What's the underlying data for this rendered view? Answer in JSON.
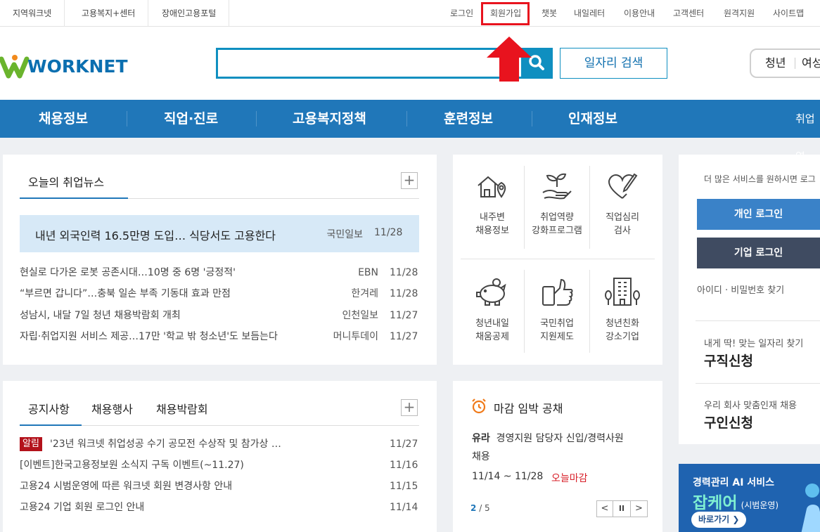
{
  "topbar": {
    "left_links": [
      "지역워크넷",
      "고용복지+센터",
      "장애인고용포털"
    ],
    "right_links": [
      "로그인",
      "회원가입",
      "챗봇",
      "내일레터",
      "이용안내",
      "고객센터",
      "원격지원",
      "사이트맵"
    ]
  },
  "header": {
    "logo": "WORKNET",
    "search_placeholder": "",
    "job_search_label": "일자리 검색",
    "toggle_a": "청년",
    "toggle_b": "여성"
  },
  "nav": {
    "items": [
      "채용정보",
      "직업·진로",
      "고용복지정책",
      "훈련정보",
      "인재정보",
      "취업역"
    ]
  },
  "news": {
    "title": "오늘의 취업뉴스",
    "plus": "+",
    "featured": {
      "headline": "내년 외국인력 16.5만명 도입… 식당서도 고용한다",
      "source": "국민일보",
      "date": "11/28"
    },
    "items": [
      {
        "headline": "현실로 다가온 로봇 공존시대…10명 중 6명 '긍정적'",
        "source": "EBN",
        "date": "11/28"
      },
      {
        "headline": "“부르면 갑니다”…충북 일손 부족 기동대 효과 만점",
        "source": "한겨레",
        "date": "11/28"
      },
      {
        "headline": "성남시, 내달 7일 청년 채용박람회 개최",
        "source": "인천일보",
        "date": "11/27"
      },
      {
        "headline": "자립·취업지원 서비스 제공…17만 '학교 밖 청소년'도 보듬는다",
        "source": "머니투데이",
        "date": "11/27"
      }
    ]
  },
  "services": [
    {
      "line1": "내주변",
      "line2": "채용정보",
      "icon": "house-location-icon"
    },
    {
      "line1": "취업역량",
      "line2": "강화프로그램",
      "icon": "sprout-hand-icon"
    },
    {
      "line1": "직업심리",
      "line2": "검사",
      "icon": "heart-pen-icon"
    },
    {
      "line1": "청년내일",
      "line2": "채움공제",
      "icon": "piggy-bank-icon"
    },
    {
      "line1": "국민취업",
      "line2": "지원제도",
      "icon": "thumbs-up-phone-icon"
    },
    {
      "line1": "청년친화",
      "line2": "강소기업",
      "icon": "building-icon"
    }
  ],
  "login": {
    "hint": "더 많은 서비스를 원하시면 로그",
    "personal_label": "개인 로그인",
    "company_label": "기업 로그인",
    "find_label": "아이디 · 비밀번호 찾기",
    "jobseek_sub": "내게 딱! 맞는 일자리 찾기",
    "jobseek_title": "구직신청",
    "hire_sub": "우리 회사 맞춤인재 채용",
    "hire_title": "구인신청"
  },
  "notice": {
    "tabs": [
      "공지사항",
      "채용행사",
      "채용박람회"
    ],
    "plus": "+",
    "badge": "알림",
    "items": [
      {
        "title": "'23년 워크넷 취업성공 수기 공모전 수상작 및 참가상 …",
        "date": "11/27"
      },
      {
        "title": "[이벤트]한국고용정보원 소식지 구독 이벤트(~11.27)",
        "date": "11/16"
      },
      {
        "title": "고용24 시범운영에 따른 워크넷 회원 변경사항 안내",
        "date": "11/15"
      },
      {
        "title": "고용24 기업 회원 로그인 안내",
        "date": "11/14"
      }
    ]
  },
  "deadline": {
    "title": "마감 임박 공채",
    "company": "유라",
    "position_1": "경영지원 담당자 신입/경력사원",
    "position_2": "채용",
    "period": "11/14 ~ 11/28",
    "status": "오늘마감",
    "page_current": "2",
    "page_total": "/ 5",
    "prev": "<",
    "pause": "II",
    "next": ">"
  },
  "banner": {
    "line1": "경력관리 AI 서비스",
    "line2": "잡케어",
    "line2_sub": "(시범운영)",
    "button": "바로가기 ❯"
  },
  "colors": {
    "nav_bg": "#2077b9",
    "accent": "#0f8fc0",
    "alert_red": "#e8131e",
    "badge_red": "#b3121b",
    "personal_login": "#3a82c8",
    "company_login": "#3f4b61",
    "banner_bg": "#1f63b0"
  }
}
